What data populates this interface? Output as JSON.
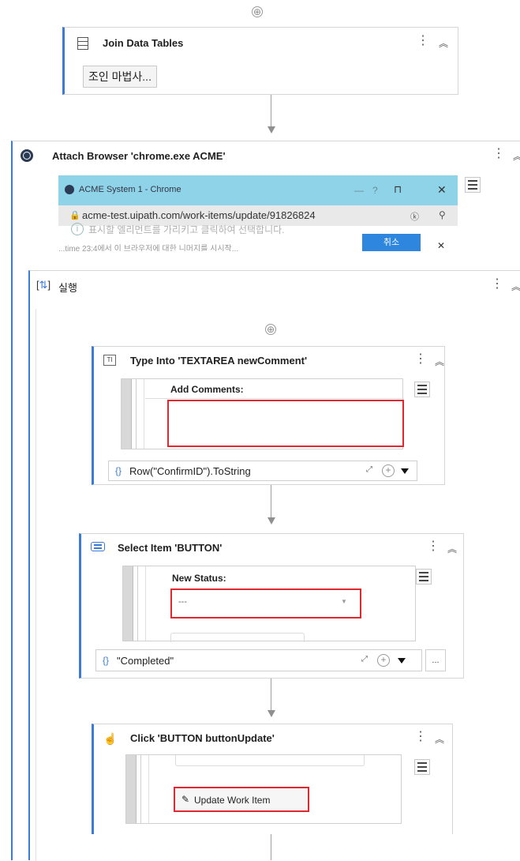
{
  "top_plus": "⊕",
  "join": {
    "title": "Join Data Tables",
    "wizard_button": "조인 마법사..."
  },
  "attach": {
    "title": "Attach Browser 'chrome.exe ACME'",
    "preview": {
      "window_title": "ACME System 1 - Chrome",
      "url": "acme-test.uipath.com/work-items/update/91826824",
      "info_text": "표시할 엘리먼트를 가리키고 클릭하여 선택합니다.",
      "bottom_text": "...time 23:4에서 이 브라우저에 대한 니머지를 시시작...",
      "blue_button": "취소"
    }
  },
  "sequence": {
    "title": "실행"
  },
  "type_into": {
    "title": "Type Into 'TEXTAREA  newComment'",
    "label": "Add Comments:",
    "value": "Row(\"ConfirmID\").ToString"
  },
  "select_item": {
    "title": "Select Item 'BUTTON'",
    "label": "New Status:",
    "dropdown_value": "---",
    "value": "\"Completed\"",
    "extra_button": "..."
  },
  "click": {
    "title": "Click 'BUTTON  buttonUpdate'",
    "button_label": "Update Work Item"
  },
  "colors": {
    "accent": "#3a7bd5",
    "highlight": "#e0282e",
    "selection_bar": "#8fd3e8"
  }
}
